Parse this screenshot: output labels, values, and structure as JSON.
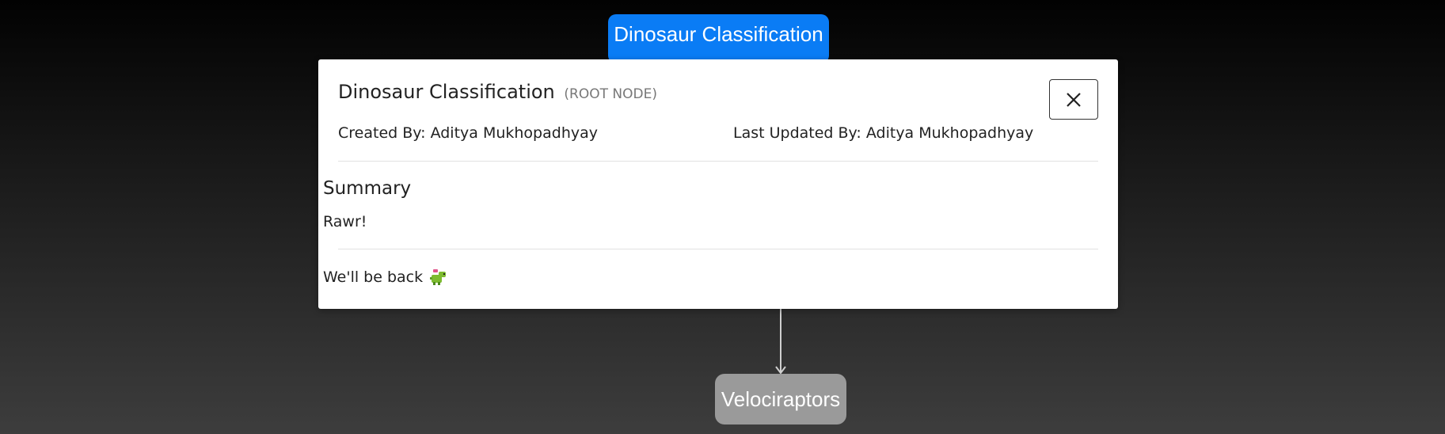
{
  "graph": {
    "root_node_label": "Dinosaur Classification",
    "child_node_label": "Velociraptors"
  },
  "modal": {
    "title": "Dinosaur Classification",
    "subtitle": "(ROOT NODE)",
    "created_by": "Created By: Aditya Mukhopadhyay",
    "last_updated_by": "Last Updated By: Aditya Mukhopadhyay",
    "summary_heading": "Summary",
    "summary_text": "Rawr!",
    "footer_text": "We'll be back",
    "footer_icon": "dinosaur-icon",
    "close_icon": "close-icon"
  },
  "colors": {
    "root_node": "#0a7cf5",
    "child_node": "#9a9a9a",
    "edge": "#cfcfcf"
  }
}
